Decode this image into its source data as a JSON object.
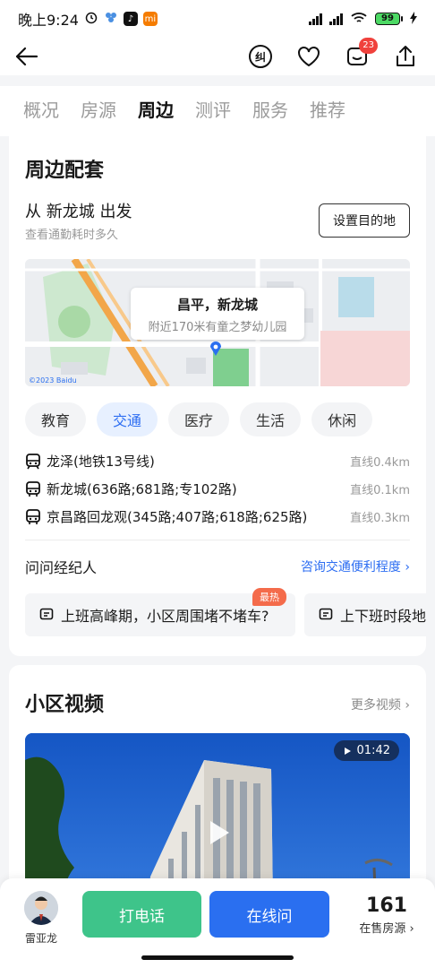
{
  "status_bar": {
    "time": "晚上9:24",
    "battery": "99"
  },
  "top_bar": {
    "cart_badge": "23"
  },
  "tabs": [
    {
      "label": "概况"
    },
    {
      "label": "房源"
    },
    {
      "label": "周边"
    },
    {
      "label": "测评"
    },
    {
      "label": "服务"
    },
    {
      "label": "推荐"
    }
  ],
  "surroundings": {
    "title": "周边配套",
    "from_line": "从 新龙城 出发",
    "sub_line": "查看通勤耗时多久",
    "destination_button": "设置目的地",
    "map": {
      "bubble_title": "昌平，新龙城",
      "bubble_sub": "附近170米有童之梦幼儿园",
      "watermark": "©2023 Baidu"
    },
    "categories": [
      {
        "label": "教育"
      },
      {
        "label": "交通"
      },
      {
        "label": "医疗"
      },
      {
        "label": "生活"
      },
      {
        "label": "休闲"
      }
    ],
    "active_category": "交通",
    "transit": [
      {
        "name": "龙泽(地铁13号线)",
        "distance": "直线0.4km",
        "icon": "subway-icon"
      },
      {
        "name": "新龙城(636路;681路;专102路)",
        "distance": "直线0.1km",
        "icon": "bus-icon"
      },
      {
        "name": "京昌路回龙观(345路;407路;618路;625路)",
        "distance": "直线0.3km",
        "icon": "bus-icon"
      }
    ],
    "ask": {
      "title": "问问经纪人",
      "link": "咨询交通便利程度"
    },
    "questions": [
      {
        "text": "上班高峰期，小区周围堵不堵车?",
        "tag": "最热"
      },
      {
        "text": "上下班时段地"
      }
    ]
  },
  "videos": {
    "title": "小区视频",
    "more": "更多视频",
    "duration": "01:42"
  },
  "bottom_bar": {
    "agent_name": "雷亚龙",
    "call_button": "打电话",
    "online_button": "在线问",
    "count": "161",
    "count_label": "在售房源"
  },
  "colors": {
    "accent_blue": "#2a6ff0",
    "call_green": "#3ec48a",
    "hot_tag": "#f46b4b",
    "badge_red": "#f0413c"
  }
}
